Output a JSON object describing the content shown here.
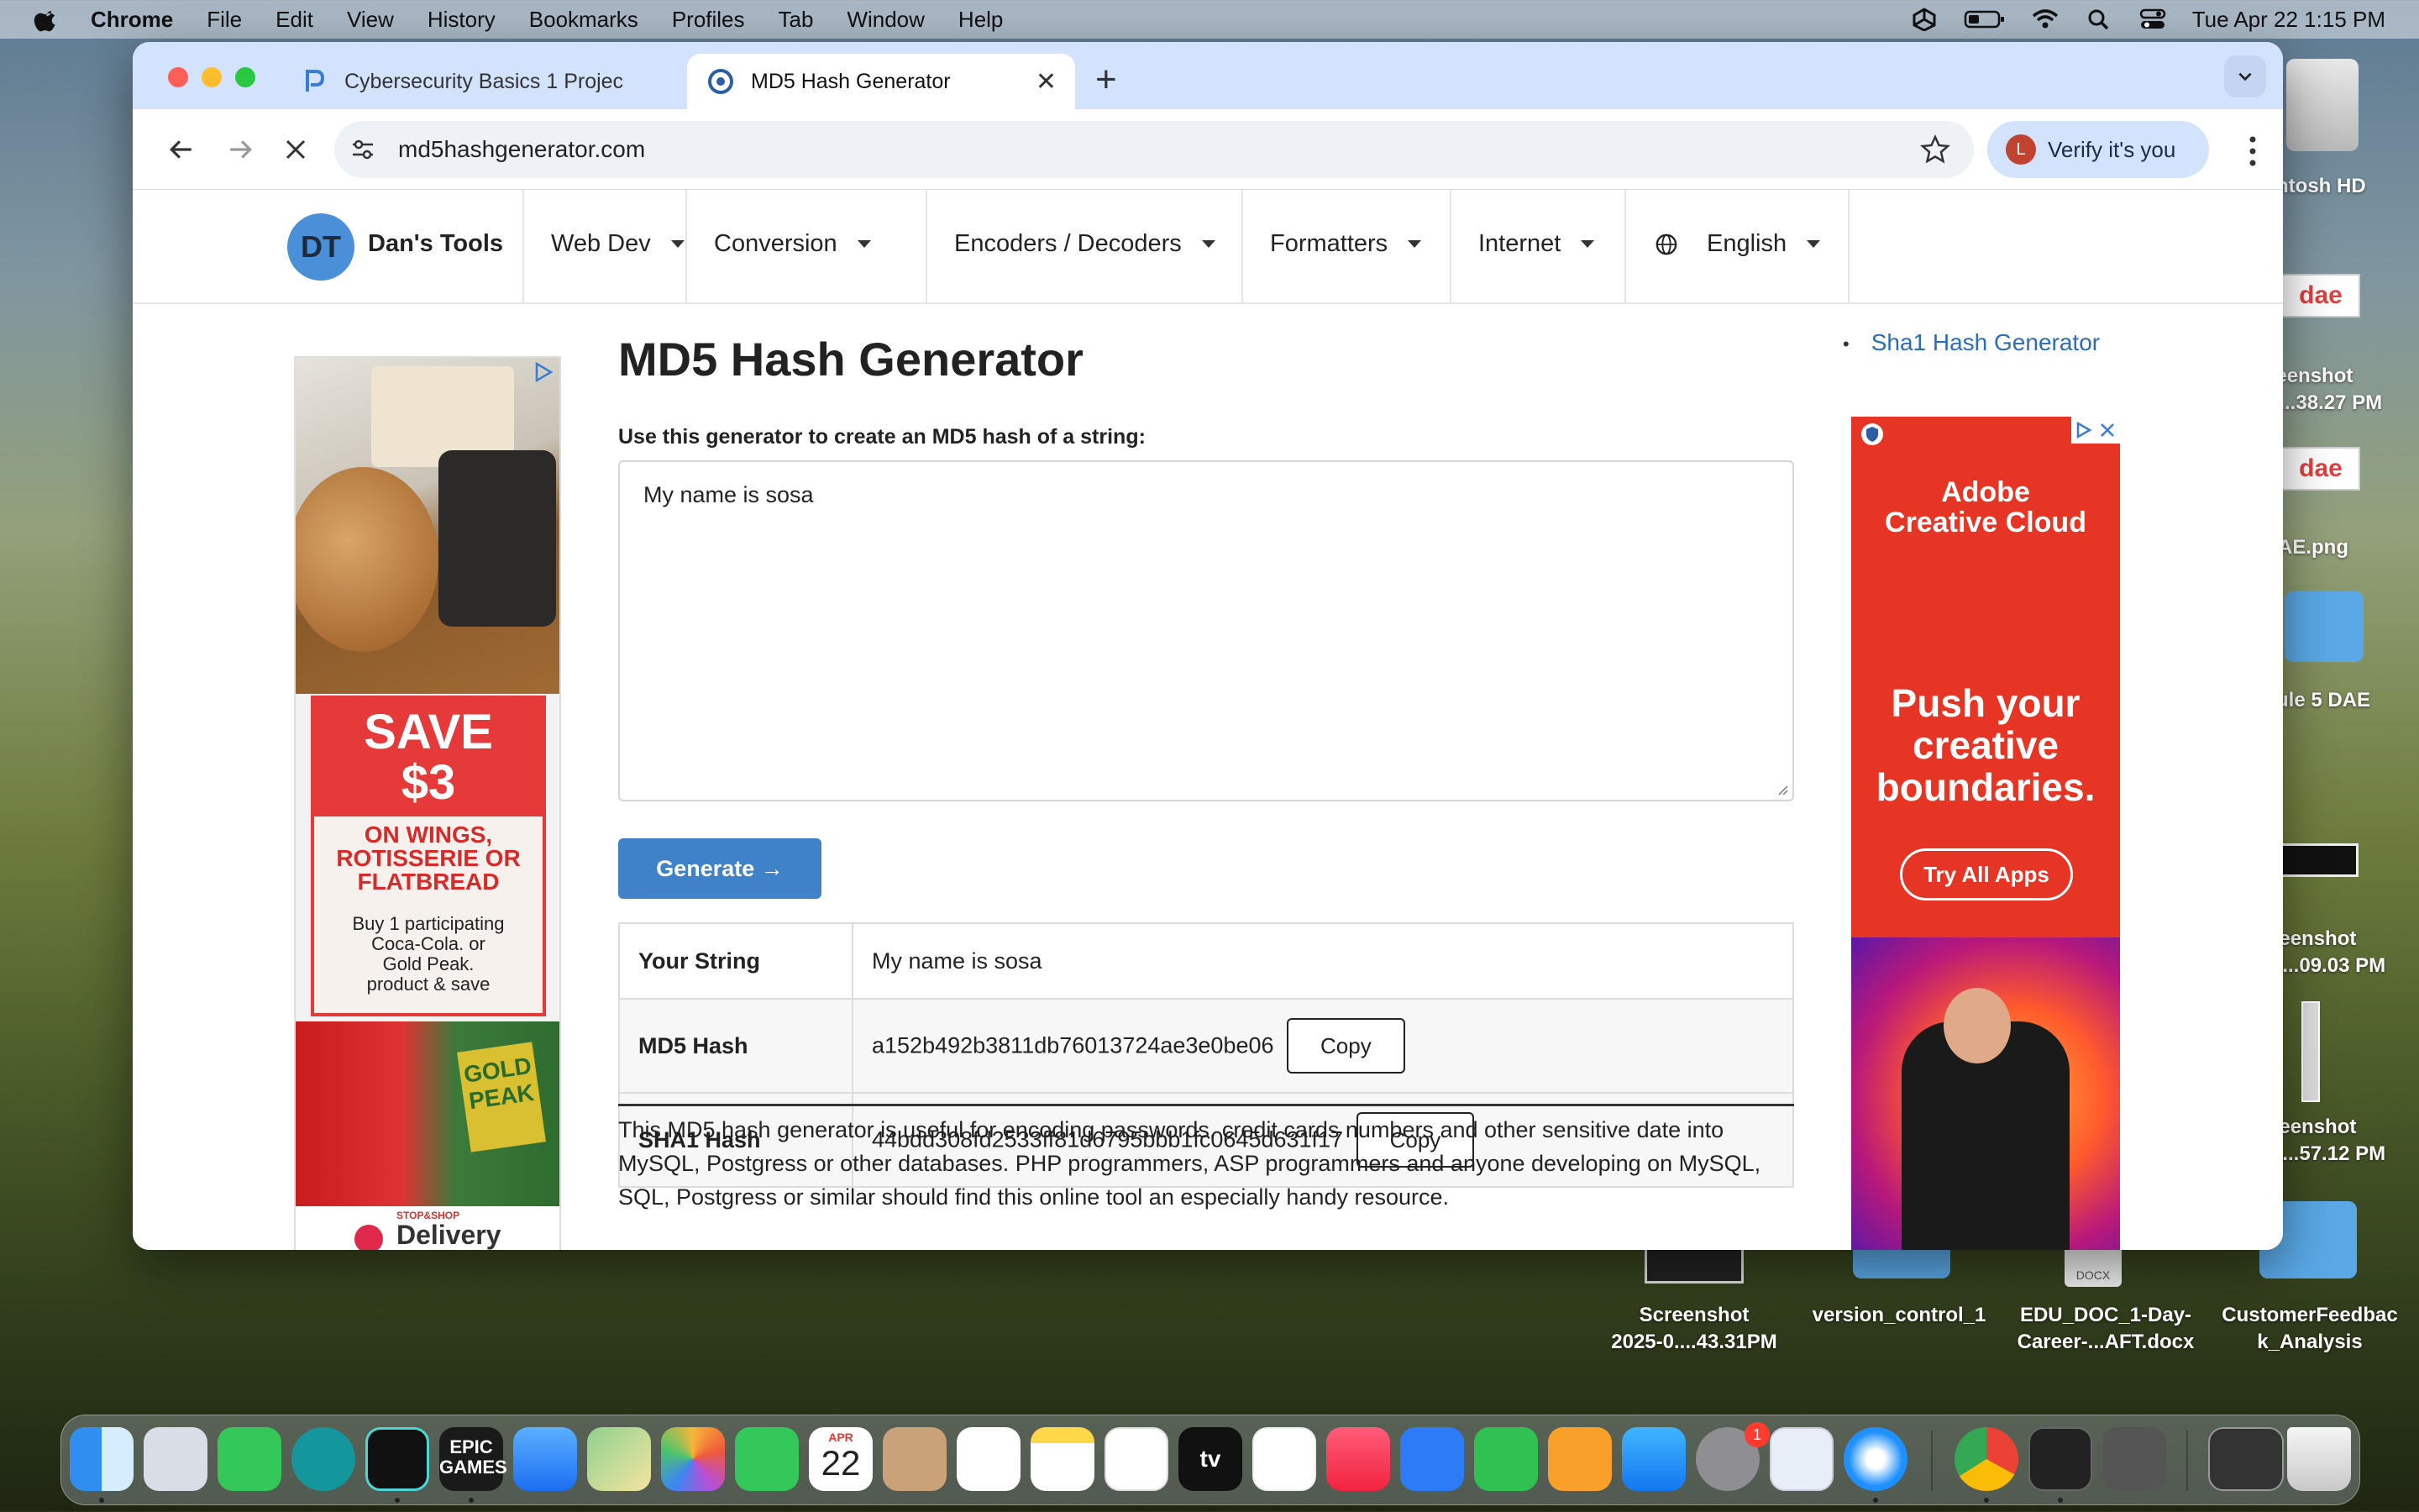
{
  "menubar": {
    "app": "Chrome",
    "items": [
      "File",
      "Edit",
      "View",
      "History",
      "Bookmarks",
      "Profiles",
      "Tab",
      "Window",
      "Help"
    ],
    "clock": "Tue Apr 22  1:15 PM"
  },
  "desktop": {
    "items": [
      {
        "label": "ntosh HD"
      },
      {
        "label": "reenshot\n0...38.27 PM"
      },
      {
        "label": "AE.png"
      },
      {
        "label": "ule 5 DAE"
      },
      {
        "label": "reenshot\n0...09.03 PM"
      },
      {
        "label": "reenshot\n0...57.12 PM"
      },
      {
        "label": "Screenshot\n2025-0....43.31PM"
      },
      {
        "label": "version_control_1"
      },
      {
        "label": "EDU_DOC_1-Day-\nCareer-...AFT.docx"
      },
      {
        "label": "CustomerFeedbac\nk_Analysis"
      }
    ],
    "dae_label": "dae",
    "docx_label": "DOCX"
  },
  "browser": {
    "tabs": [
      {
        "title": "Cybersecurity Basics 1 Projec",
        "active": false
      },
      {
        "title": "MD5 Hash Generator",
        "active": true
      }
    ],
    "url": "md5hashgenerator.com",
    "profile_label": "Verify it's you",
    "profile_initial": "L"
  },
  "site": {
    "logo": "DT",
    "brand": "Dan's Tools",
    "nav": [
      "Web Dev",
      "Conversion",
      "Encoders / Decoders",
      "Formatters",
      "Internet",
      "English"
    ]
  },
  "main": {
    "title": "MD5 Hash Generator",
    "input_label": "Use this generator to create an MD5 hash of a string:",
    "input_value": "My name is sosa",
    "generate_label": "Generate →",
    "results": [
      {
        "key": "Your String",
        "value": "My name is sosa"
      },
      {
        "key": "MD5 Hash",
        "value": "a152b492b3811db76013724ae3e0be06",
        "copy": "Copy"
      },
      {
        "key": "SHA1 Hash",
        "value": "44bdd308fd2533ff81d6795bbb1fc0645d631f17",
        "copy": "Copy"
      }
    ],
    "description": "This MD5 hash generator is useful for encoding passwords, credit cards numbers and other sensitive date into MySQL, Postgress or other databases. PHP programmers, ASP programmers and anyone developing on MySQL, SQL, Postgress or similar should find this online tool an especially handy resource."
  },
  "sidebar": {
    "link": "Sha1 Hash Generator"
  },
  "ads": {
    "left": {
      "save": "SAVE\n$3",
      "promo": "ON WINGS,\nROTISSERIE OR\nFLATBREAD",
      "fine": "Buy 1 participating\nCoca-Cola. or\nGold Peak.\nproduct & save",
      "gold_peak": "GOLD\nPEAK",
      "store": "STOP&SHOP",
      "delivery": "Delivery\n& Pickup"
    },
    "right": {
      "brand": "Adobe\nCreative Cloud",
      "headline": "Push your\ncreative\nboundaries.",
      "cta": "Try All Apps"
    }
  },
  "dock": {
    "calendar_month": "APR",
    "calendar_day": "22",
    "epic_label": "EPIC\nGAMES",
    "tv_label": "tv",
    "badge": "1"
  },
  "colors": {
    "accent": "#3f82c9",
    "tabstrip": "#d3e3fd",
    "link": "#2a6db8",
    "ad_red": "#e63a3a",
    "adobe_red": "#e63524"
  }
}
